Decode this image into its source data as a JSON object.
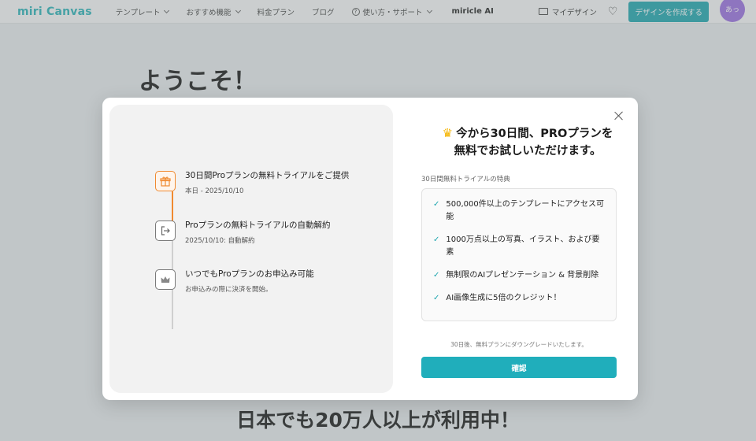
{
  "header": {
    "logo": "miri Canvas",
    "nav": [
      {
        "label": "テンプレート",
        "has_dropdown": true
      },
      {
        "label": "おすすめ機能",
        "has_dropdown": true
      },
      {
        "label": "料金プラン",
        "has_dropdown": false
      },
      {
        "label": "ブログ",
        "has_dropdown": false
      },
      {
        "label": "使い方・サポート",
        "has_dropdown": true
      }
    ],
    "miricle_label": "miricle AI",
    "my_design_label": "マイデザイン",
    "create_button": "デザインを作成する",
    "avatar_text": "あっ"
  },
  "page": {
    "welcome": "ようこそ！",
    "banner": "日本でも20万人以上が利用中！"
  },
  "modal": {
    "steps": [
      {
        "title": "30日間Proプランの無料トライアルをご提供",
        "sub": "本日 - 2025/10/10",
        "icon": "gift-icon"
      },
      {
        "title": "Proプランの無料トライアルの自動解約",
        "sub": "2025/10/10: 自動解約",
        "icon": "exit-icon"
      },
      {
        "title": "いつでもProプランのお申込み可能",
        "sub": "お申込みの際に決済を開始。",
        "icon": "crown-icon"
      }
    ],
    "headline_line1": "今から30日間、PROプランを",
    "headline_line2": "無料でお試しいただけます。",
    "benefits_label": "30日間無料トライアルの特典",
    "benefits": [
      "500,000件以上のテンプレートにアクセス可能",
      "1000万点以上の写真、イラスト、および要素",
      "無制限のAIプレゼンテーション & 背景削除",
      "AI画像生成に5倍のクレジット！"
    ],
    "downgrade_note": "30日後、無料プランにダウングレードいたします。",
    "confirm_button": "確認"
  },
  "colors": {
    "brand": "#2cb3b8",
    "accent_button": "#20aebb",
    "active_step": "#f08a30",
    "crown": "#f5b400",
    "avatar": "#9a6fe0"
  }
}
